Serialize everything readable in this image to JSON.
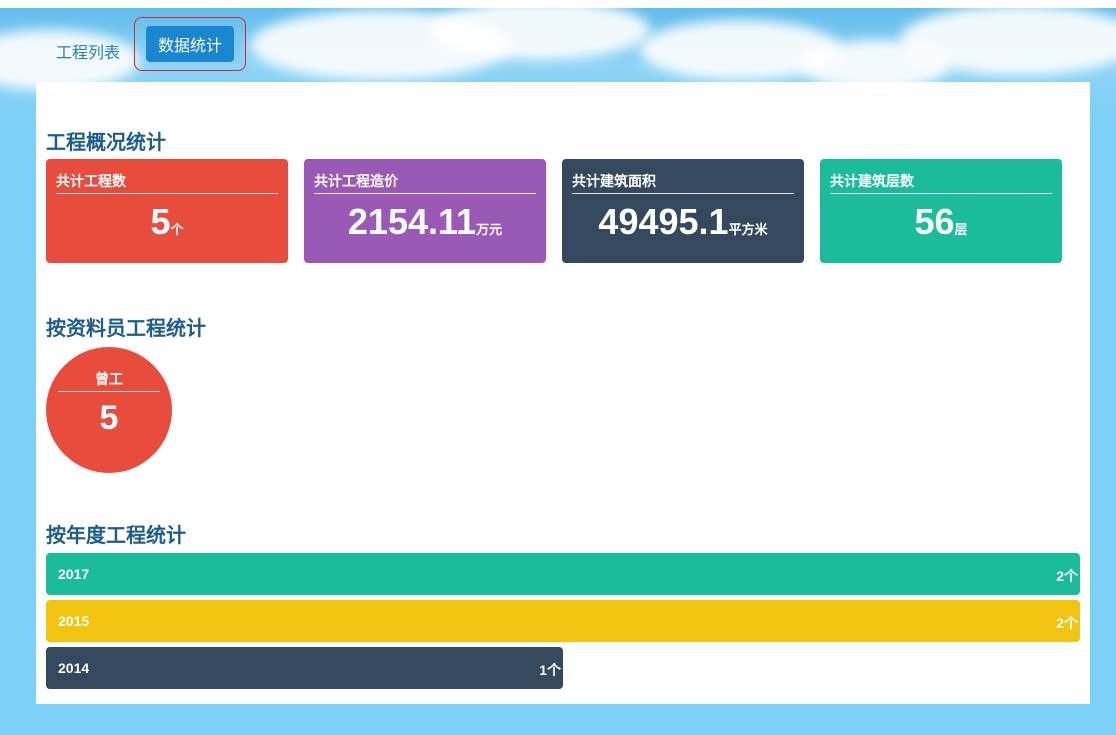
{
  "tabs": [
    {
      "label": "工程列表",
      "active": false
    },
    {
      "label": "数据统计",
      "active": true
    }
  ],
  "overview": {
    "title": "工程概况统计",
    "cards": [
      {
        "label": "共计工程数",
        "value": "5",
        "unit": "个",
        "color": "#e74c3c"
      },
      {
        "label": "共计工程造价",
        "value": "2154.11",
        "unit": "万元",
        "color": "#9b59b6"
      },
      {
        "label": "共计建筑面积",
        "value": "49495.1",
        "unit": "平方米",
        "color": "#34495e"
      },
      {
        "label": "共计建筑层数",
        "value": "56",
        "unit": "层",
        "color": "#1abc9c"
      }
    ]
  },
  "by_staff": {
    "title": "按资料员工程统计",
    "items": [
      {
        "name": "曾工",
        "count": "5",
        "color": "#e74c3c"
      }
    ]
  },
  "by_year": {
    "title": "按年度工程统计",
    "items": [
      {
        "year": "2017",
        "count_label": "2个",
        "count": 2,
        "color": "#1abc9c"
      },
      {
        "year": "2015",
        "count_label": "2个",
        "count": 2,
        "color": "#f1c40f"
      },
      {
        "year": "2014",
        "count_label": "1个",
        "count": 1,
        "color": "#34495e"
      }
    ]
  }
}
